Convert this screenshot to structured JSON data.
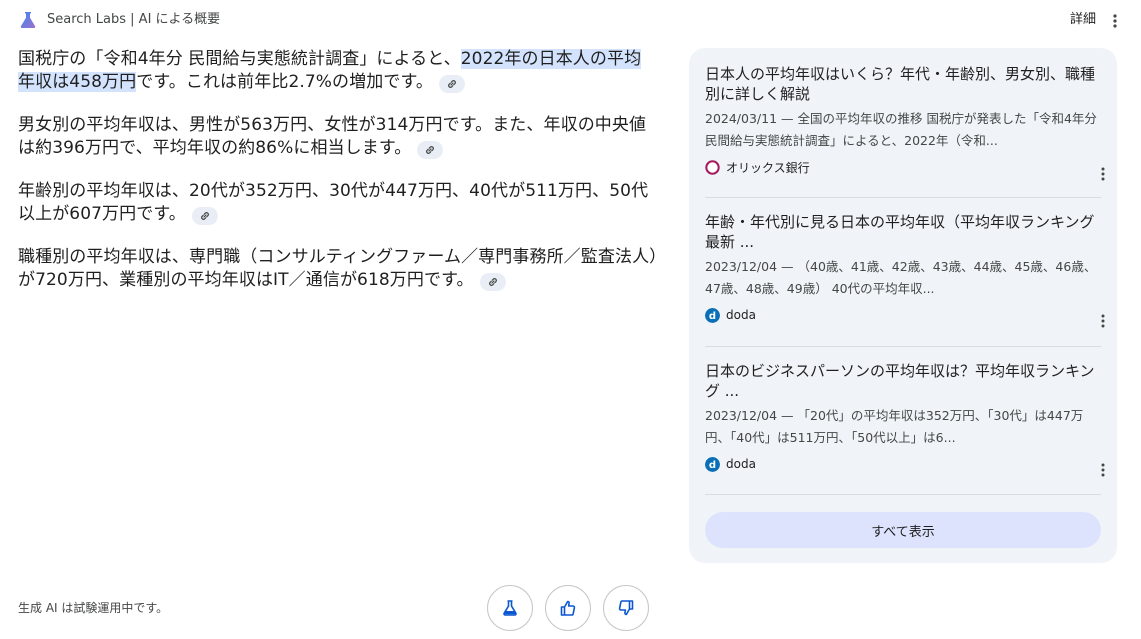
{
  "header": {
    "title": "Search Labs | AI による概要",
    "details_label": "詳細"
  },
  "answer": {
    "p1_pre": "国税庁の「令和4年分 民間給与実態統計調査」によると、",
    "p1_highlight": "2022年の日本人の平均年収は458万円",
    "p1_post": "です。これは前年比2.7%の増加です。",
    "p2": "男女別の平均年収は、男性が563万円、女性が314万円です。また、年収の中央値は約396万円で、平均年収の約86%に相当します。",
    "p3": "年齢別の平均年収は、20代が352万円、30代が447万円、40代が511万円、50代以上が607万円です。",
    "p4": "職種別の平均年収は、専門職（コンサルティングファーム／専門事務所／監査法人）が720万円、業種別の平均年収はIT／通信が618万円です。"
  },
  "footer": {
    "note": "生成 AI は試験運用中です。"
  },
  "sources": [
    {
      "title": "日本人の平均年収はいくら？年代・年齢別、男女別、職種別に詳しく解説",
      "snippet": "2024/03/11 — 全国の平均年収の推移 国税庁が発表した「令和4年分 民間給与実態統計調査」によると、2022年（令和...",
      "site": "オリックス銀行",
      "icon_color": "#a3195b"
    },
    {
      "title": "年齢・年代別に見る日本の平均年収（平均年収ランキング最新 ...",
      "snippet": "2023/12/04 — （40歳、41歳、42歳、43歳、44歳、45歳、46歳、47歳、48歳、49歳） 40代の平均年収...",
      "site": "doda",
      "icon_color": "#0a6fb7"
    },
    {
      "title": "日本のビジネスパーソンの平均年収は？平均年収ランキング ...",
      "snippet": "2023/12/04 — 「20代」の平均年収は352万円、「30代」は447万円、「40代」は511万円、「50代以上」は6...",
      "site": "doda",
      "icon_color": "#0a6fb7"
    }
  ],
  "show_all_label": "すべて表示",
  "colors": {
    "highlight": "#d3e3fd",
    "panel_bg": "#f0f4f9",
    "accent": "#4285f4"
  }
}
